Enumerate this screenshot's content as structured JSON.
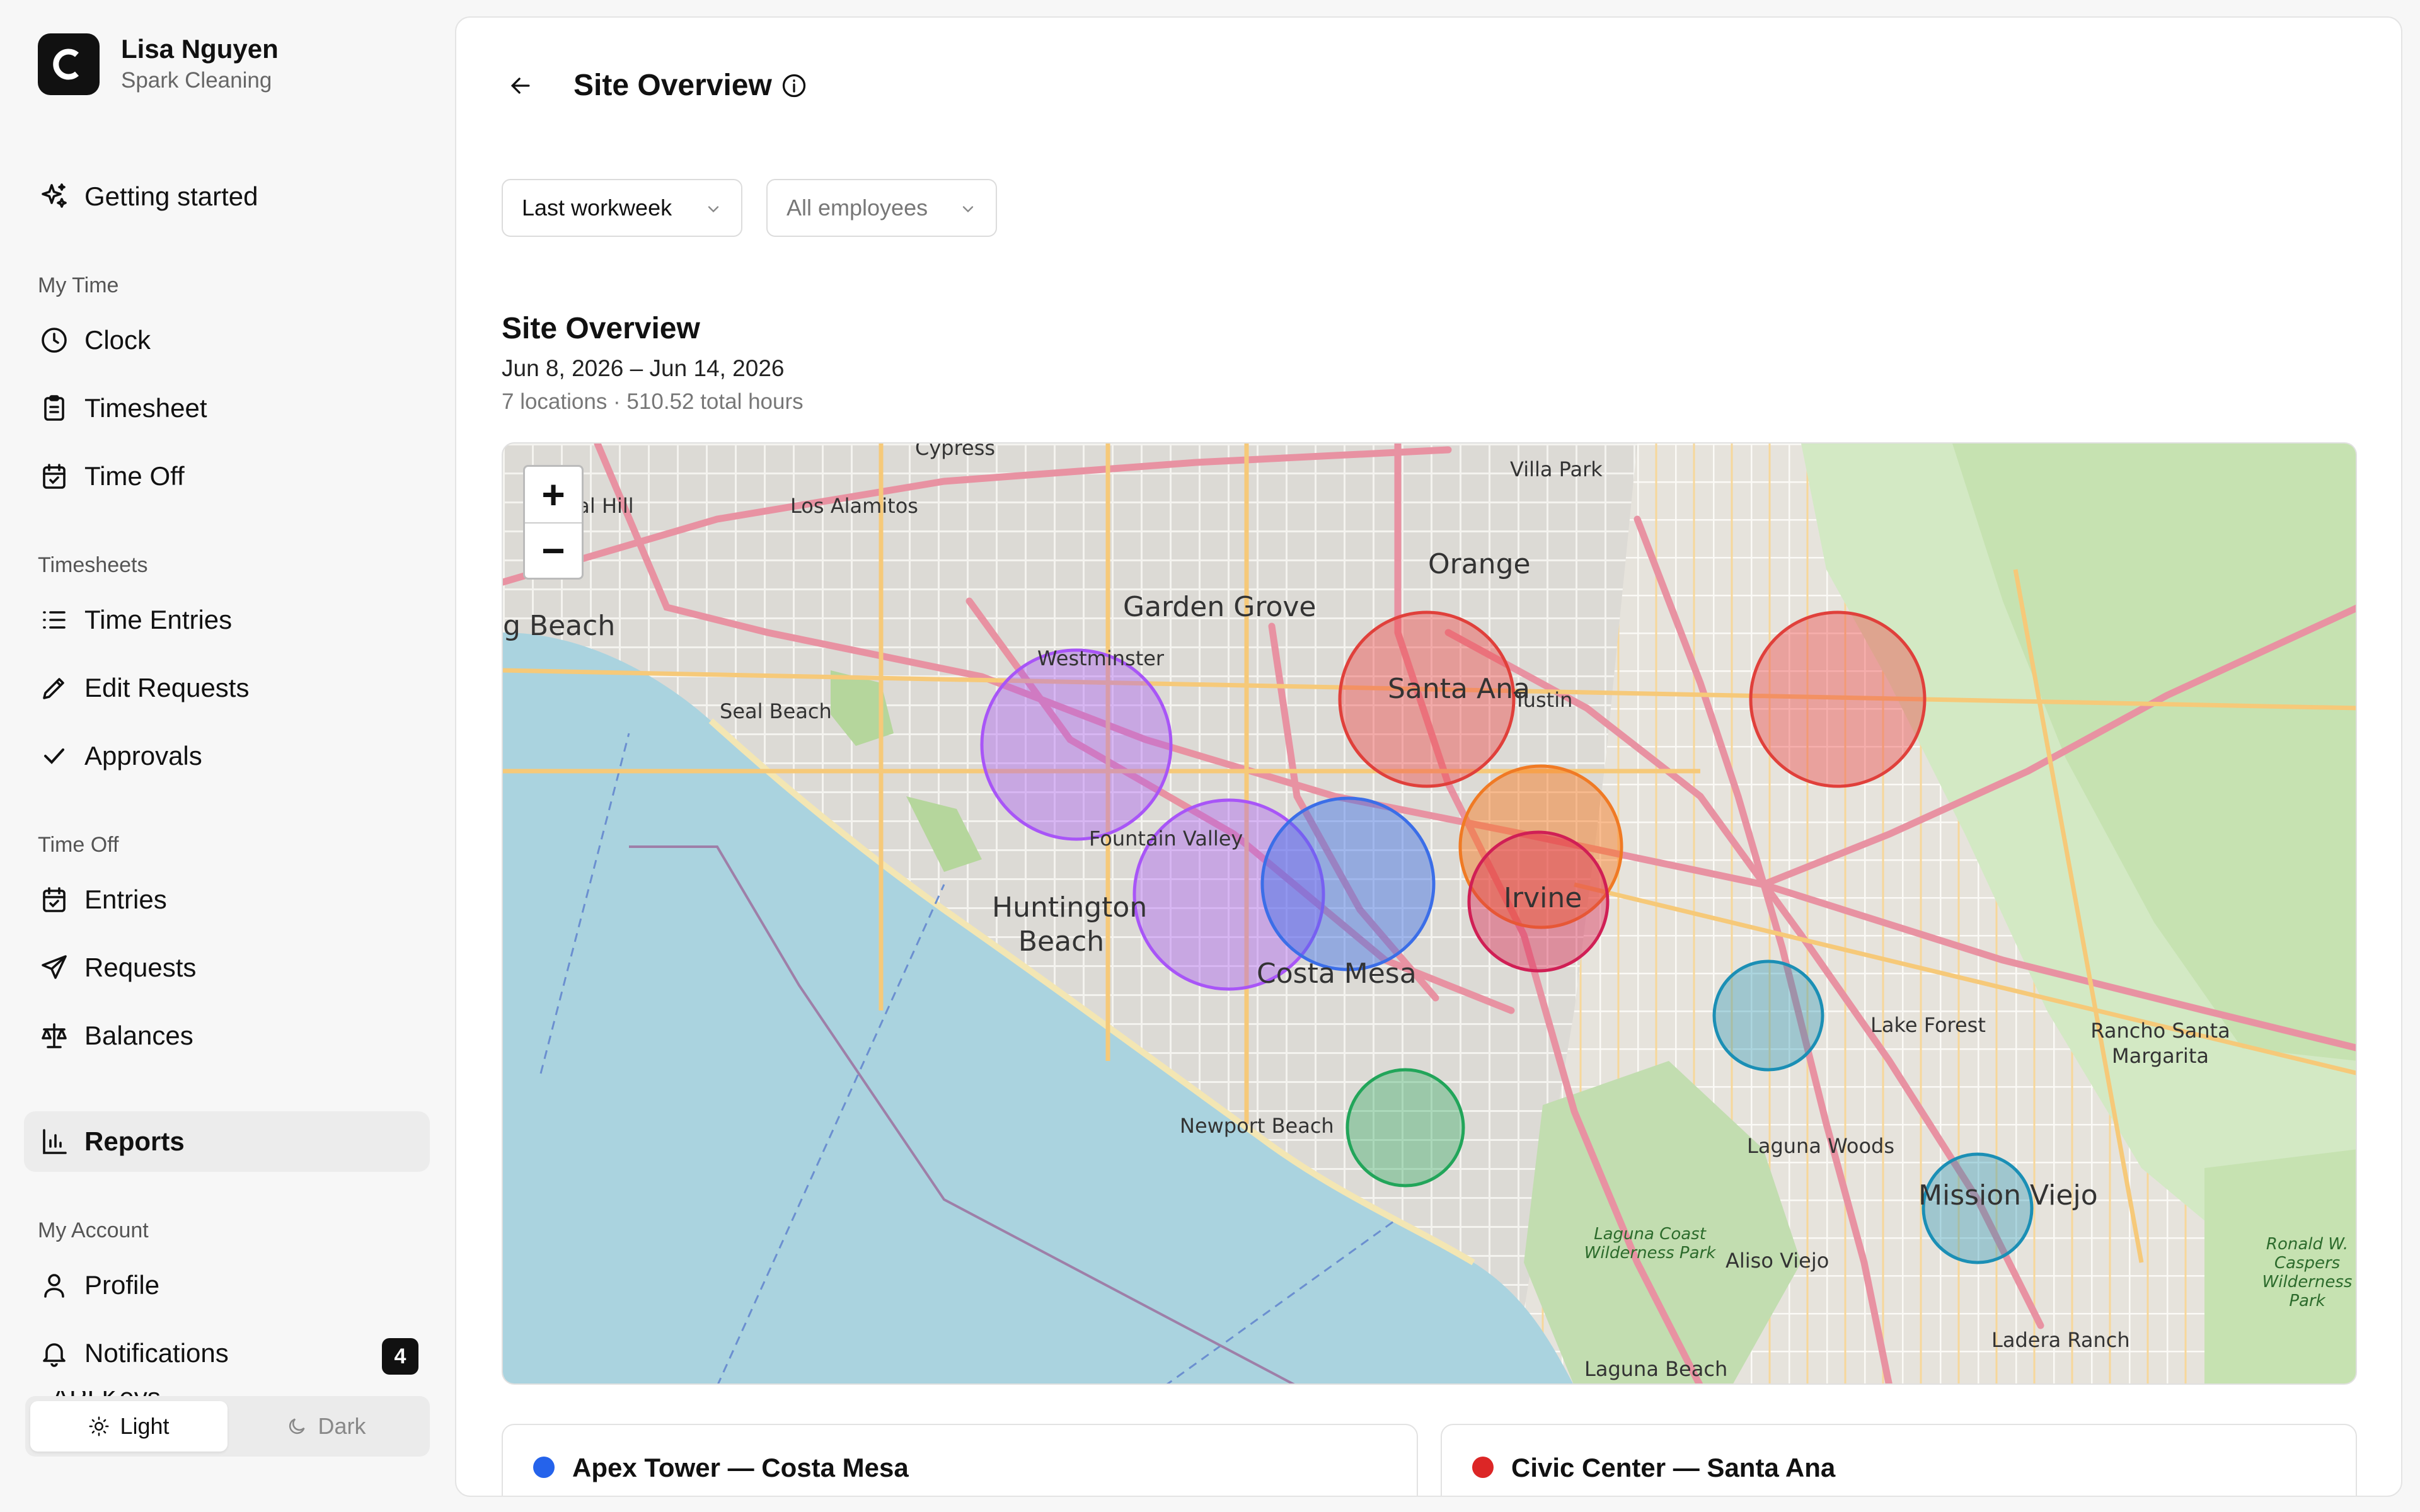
{
  "org": {
    "logo_letter": "C",
    "user_name": "Lisa Nguyen",
    "company": "Spark Cleaning"
  },
  "nav": {
    "getting_started": "Getting started",
    "sections": {
      "my_time": "My Time",
      "timesheets": "Timesheets",
      "time_off": "Time Off",
      "my_account": "My Account"
    },
    "my_time": [
      "Clock",
      "Timesheet",
      "Time Off"
    ],
    "timesheets": [
      "Time Entries",
      "Edit Requests",
      "Approvals"
    ],
    "time_off": [
      "Entries",
      "Requests",
      "Balances"
    ],
    "reports": "Reports",
    "my_account": [
      "Profile",
      "Notifications",
      "API Keys"
    ],
    "notifications_badge": "4"
  },
  "theme": {
    "light": "Light",
    "dark": "Dark",
    "selected": "light"
  },
  "page": {
    "title": "Site Overview"
  },
  "filters": {
    "period": "Last workweek",
    "employees": "All employees"
  },
  "overview": {
    "title": "Site Overview",
    "date_range": "Jun 8, 2026 – Jun 14, 2026",
    "meta": "7 locations · 510.52 total hours"
  },
  "map": {
    "zoom_in": "+",
    "zoom_out": "−",
    "labels": {
      "orange": "Orange",
      "garden_grove": "Garden Grove",
      "santa_ana": "Santa Ana",
      "westminster": "Westminster",
      "long_beach": "g Beach",
      "seal_beach": "Seal Beach",
      "los_alamitos": "Los Alamitos",
      "villa_park": "Villa Park",
      "tustin": "Tustin",
      "fountain_valley": "Fountain Valley",
      "huntington_beach": "Huntington Beach",
      "costa_mesa": "Costa Mesa",
      "irvine": "Irvine",
      "newport_beach": "Newport Beach",
      "lake_forest": "Lake Forest",
      "rancho_santa_margarita": "Rancho Santa Margarita",
      "laguna_woods": "Laguna Woods",
      "mission_viejo": "Mission Viejo",
      "aliso_viejo": "Aliso Viejo",
      "laguna_beach": "Laguna Beach",
      "ladera_ranch": "Ladera Ranch",
      "laguna_park": "Laguna Coast Wilderness Park",
      "ronald_park": "Ronald W. Caspers Wilderness Park",
      "hawaiian_gardens": "nal Hill",
      "cypress": "Cypress"
    },
    "markers": [
      {
        "name": "Westminster site",
        "color": "#a855f7"
      },
      {
        "name": "Santa Ana site",
        "color": "#ef4444"
      },
      {
        "name": "Costa Mesa site",
        "color": "#3b6ee8"
      },
      {
        "name": "Irvine site A",
        "color": "#f97316"
      },
      {
        "name": "Irvine site B",
        "color": "#dc2650"
      },
      {
        "name": "Lake Forest site",
        "color": "#1b8fb5"
      },
      {
        "name": "Newport Beach site",
        "color": "#22a55a"
      }
    ]
  },
  "locations": [
    {
      "name": "Apex Tower — Costa Mesa",
      "color": "#2563eb"
    },
    {
      "name": "Civic Center — Santa Ana",
      "color": "#dc2626"
    }
  ]
}
